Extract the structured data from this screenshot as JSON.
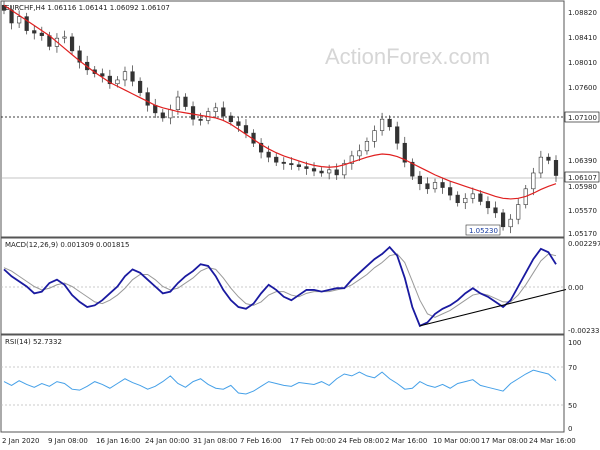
{
  "chart_data": [
    {
      "type": "candlestick",
      "title": "EURCHF,H4  1.06116 1.06141 1.06092 1.06107",
      "watermark": "ActionForex.com",
      "ylim": [
        1.0517,
        1.0882
      ],
      "y_ticks": [
        "1.08820",
        "1.08410",
        "1.08010",
        "1.07600",
        "1.07100",
        "1.06390",
        "1.06107",
        "1.05980",
        "1.05570",
        "1.05170"
      ],
      "horizontal_lines": [
        {
          "value": 1.071,
          "style": "dotted",
          "label": "1.07100"
        },
        {
          "value": 1.06107,
          "style": "solid",
          "label": "1.06107"
        }
      ],
      "annotation": {
        "label": "1.05230",
        "value": 1.0523
      },
      "close_series": [
        1.0872,
        1.0852,
        1.0862,
        1.084,
        1.0836,
        1.0832,
        1.0815,
        1.0828,
        1.083,
        1.0808,
        1.079,
        1.0778,
        1.0772,
        1.0768,
        1.0756,
        1.0762,
        1.0775,
        1.076,
        1.0742,
        1.0722,
        1.071,
        1.0702,
        1.0715,
        1.0735,
        1.072,
        1.07,
        1.0698,
        1.0712,
        1.0718,
        1.0705,
        1.0696,
        1.069,
        1.0678,
        1.0662,
        1.0648,
        1.064,
        1.0632,
        1.063,
        1.0628,
        1.0625,
        1.0622,
        1.0618,
        1.0615,
        1.062,
        1.0612,
        1.063,
        1.0642,
        1.065,
        1.0665,
        1.0682,
        1.07,
        1.0688,
        1.0662,
        1.0632,
        1.061,
        1.0598,
        1.059,
        1.06,
        1.0592,
        1.058,
        1.0568,
        1.0575,
        1.0582,
        1.057,
        1.056,
        1.0552,
        1.053,
        1.0542,
        1.0565,
        1.059,
        1.0615,
        1.064,
        1.0635,
        1.0611
      ],
      "ma_series": [
        1.088,
        1.0872,
        1.0864,
        1.0856,
        1.0848,
        1.084,
        1.0832,
        1.0822,
        1.0812,
        1.0802,
        1.0792,
        1.0783,
        1.0774,
        1.0766,
        1.0758,
        1.0752,
        1.0746,
        1.074,
        1.0734,
        1.0728,
        1.0722,
        1.0718,
        1.0715,
        1.0712,
        1.071,
        1.0708,
        1.0706,
        1.0704,
        1.0702,
        1.0698,
        1.0692,
        1.0684,
        1.0676,
        1.0668,
        1.066,
        1.0653,
        1.0647,
        1.0642,
        1.0638,
        1.0634,
        1.063,
        1.0627,
        1.0625,
        1.0624,
        1.0625,
        1.0628,
        1.0632,
        1.0636,
        1.064,
        1.0643,
        1.0645,
        1.0644,
        1.0641,
        1.0636,
        1.063,
        1.0624,
        1.0618,
        1.0612,
        1.0607,
        1.0602,
        1.0598,
        1.0594,
        1.059,
        1.0586,
        1.0582,
        1.0578,
        1.0575,
        1.0574,
        1.0575,
        1.0578,
        1.0583,
        1.0589,
        1.0594,
        1.0598
      ]
    },
    {
      "type": "line",
      "title": "MACD(12,26,9) 0.001309 0.001815",
      "ylim": [
        -0.0026,
        0.0026
      ],
      "y_ticks": [
        "0.002297",
        "0.00",
        "-0.002336"
      ],
      "series": [
        {
          "role": "macd",
          "values": [
            0.001,
            0.0006,
            0.0003,
            0.0,
            -0.0004,
            -0.0003,
            0.0002,
            0.0004,
            0.0001,
            -0.0005,
            -0.0009,
            -0.0012,
            -0.0011,
            -0.0008,
            -0.0004,
            0.0,
            0.0006,
            0.001,
            0.0008,
            0.0004,
            0.0,
            -0.0004,
            -0.0003,
            0.0002,
            0.0006,
            0.0009,
            0.0013,
            0.0012,
            0.0006,
            -0.0002,
            -0.0008,
            -0.0012,
            -0.0013,
            -0.001,
            -0.0004,
            0.0001,
            -0.0002,
            -0.0006,
            -0.0008,
            -0.0005,
            -0.0002,
            -0.0002,
            -0.0003,
            -0.0002,
            -0.0001,
            -0.0001,
            0.0004,
            0.0008,
            0.0012,
            0.0016,
            0.0019,
            0.0023,
            0.0018,
            0.0005,
            -0.0012,
            -0.0023,
            -0.0021,
            -0.0016,
            -0.0013,
            -0.0011,
            -0.0008,
            -0.0004,
            -0.0001,
            -0.0004,
            -0.0006,
            -0.0009,
            -0.0012,
            -0.0008,
            0.0,
            0.0008,
            0.0016,
            0.0022,
            0.002,
            0.0013
          ]
        },
        {
          "role": "signal",
          "values": [
            0.0011,
            0.0009,
            0.0006,
            0.0003,
            0.0,
            -0.0002,
            -0.0001,
            0.0001,
            0.0002,
            0.0,
            -0.0003,
            -0.0006,
            -0.0009,
            -0.001,
            -0.0008,
            -0.0005,
            -0.0001,
            0.0004,
            0.0007,
            0.0007,
            0.0004,
            0.0,
            -0.0002,
            -0.0001,
            0.0002,
            0.0005,
            0.0009,
            0.0011,
            0.001,
            0.0005,
            -0.0001,
            -0.0006,
            -0.001,
            -0.0011,
            -0.0009,
            -0.0005,
            -0.0003,
            -0.0003,
            -0.0005,
            -0.0006,
            -0.0004,
            -0.0003,
            -0.0003,
            -0.0003,
            -0.0002,
            -0.0001,
            0.0001,
            0.0004,
            0.0007,
            0.0011,
            0.0014,
            0.0018,
            0.0019,
            0.0014,
            0.0003,
            -0.0008,
            -0.0016,
            -0.0018,
            -0.0016,
            -0.0014,
            -0.0011,
            -0.0008,
            -0.0005,
            -0.0004,
            -0.0005,
            -0.0007,
            -0.0009,
            -0.0009,
            -0.0005,
            0.0001,
            0.0008,
            0.0015,
            0.0019,
            0.0018
          ]
        }
      ],
      "trendline": {
        "from": {
          "index": 55,
          "value": -0.0023
        },
        "to": {
          "index": 73,
          "value": -0.0006
        }
      }
    },
    {
      "type": "line",
      "title": "RSI(14) 52.7332",
      "ylim": [
        0,
        100
      ],
      "y_ticks": [
        "100",
        "70",
        "50",
        "0"
      ],
      "levels": [
        70,
        30
      ],
      "series": [
        {
          "role": "rsi",
          "values": [
            52,
            48,
            53,
            49,
            46,
            50,
            47,
            52,
            50,
            44,
            43,
            47,
            52,
            49,
            45,
            50,
            55,
            51,
            48,
            44,
            47,
            52,
            58,
            50,
            46,
            52,
            55,
            49,
            45,
            44,
            48,
            40,
            39,
            42,
            47,
            52,
            50,
            48,
            47,
            51,
            50,
            49,
            52,
            48,
            55,
            60,
            58,
            62,
            58,
            56,
            62,
            55,
            50,
            44,
            45,
            52,
            48,
            46,
            49,
            45,
            50,
            52,
            54,
            48,
            46,
            44,
            42,
            50,
            55,
            60,
            64,
            62,
            60,
            53
          ]
        }
      ]
    }
  ],
  "x_axis_labels": [
    "2 Jan 2020",
    "9 Jan 08:00",
    "16 Jan 16:00",
    "24 Jan 00:00",
    "31 Jan 08:00",
    "7 Feb 16:00",
    "17 Feb 00:00",
    "24 Feb 08:00",
    "2 Mar 16:00",
    "10 Mar 00:00",
    "17 Mar 08:00",
    "24 Mar 16:00"
  ],
  "colors": {
    "candle": "#333333",
    "ma": "#e02020",
    "macd": "#1a1aa0",
    "signal": "#9a9a9a",
    "rsi": "#45a0e8",
    "trend": "#000000",
    "grid": "#c0c0c0",
    "watermark": "#d6d6d6"
  }
}
